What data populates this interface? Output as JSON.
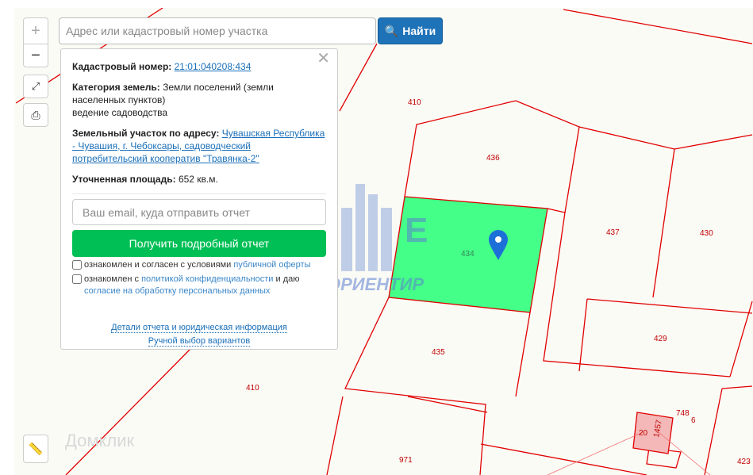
{
  "search": {
    "placeholder": "Адрес или кадастровый номер участка",
    "button": "Найти"
  },
  "zoom": {
    "in": "+",
    "out": "−"
  },
  "panel": {
    "cadastral_label": "Кадастровый номер:",
    "cadastral_value": "21:01:040208:434",
    "category_label": "Категория земель:",
    "category_value": "Земли поселений (земли населенных пунктов)",
    "usage": "ведение садоводства",
    "address_label": "Земельный участок по адресу:",
    "address_value": "Чувашская Республика - Чувашия, г. Чебоксары, садоводческий потребительский кооператив \"Травянка-2\"",
    "area_label": "Уточненная площадь:",
    "area_value": "652 кв.м.",
    "email_placeholder": "Ваш email, куда отправить отчет",
    "get_report": "Получить подробный отчет",
    "check1_text": "ознакомлен и согласен с условиями ",
    "check1_link": "публичной оферты",
    "check2_text": "ознакомлен с ",
    "check2_link": "политикой конфиденциальности",
    "check2_mid": " и даю",
    "check2_link2": "согласие на обработку персональных данных",
    "details_link": "Детали отчета и юридическая информация",
    "manual_link": "Ручной выбор вариантов"
  },
  "map": {
    "labels": [
      "410",
      "436",
      "434",
      "437",
      "430",
      "429",
      "435",
      "410",
      "748",
      "6",
      "20",
      "1457",
      "971",
      "423"
    ],
    "watermark": "ОРИЕНТИР",
    "domclick": "Домклик",
    "highlight_color": "#44ff88",
    "line_color": "#e00000"
  }
}
